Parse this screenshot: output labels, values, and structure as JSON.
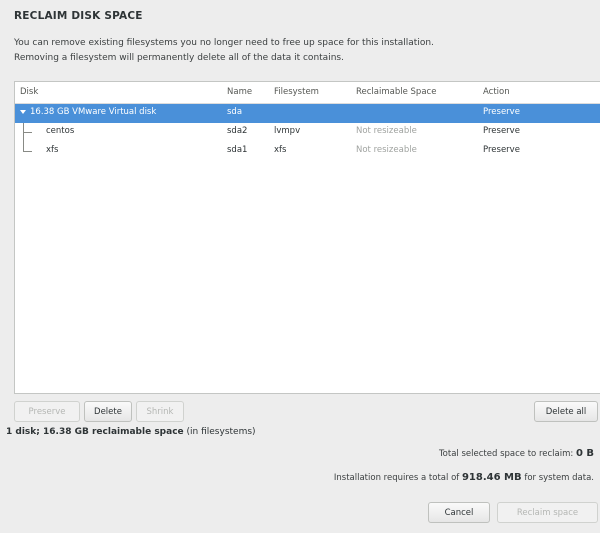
{
  "dialog": {
    "title": "RECLAIM DISK SPACE",
    "description_line1": "You can remove existing filesystems you no longer need to free up space for this installation.",
    "description_line2": "Removing a filesystem will permanently delete all of the data it contains."
  },
  "table": {
    "columns": [
      "Disk",
      "Name",
      "Filesystem",
      "Reclaimable Space",
      "Action"
    ],
    "rows": [
      {
        "disk": "16.38 GB VMware Virtual disk",
        "name": "sda",
        "filesystem": "",
        "reclaimable": "",
        "action": "Preserve",
        "selected": true
      },
      {
        "disk": "centos",
        "name": "sda2",
        "filesystem": "lvmpv",
        "reclaimable": "Not resizeable",
        "action": "Preserve",
        "selected": false
      },
      {
        "disk": "xfs",
        "name": "sda1",
        "filesystem": "xfs",
        "reclaimable": "Not resizeable",
        "action": "Preserve",
        "selected": false
      }
    ]
  },
  "toolbar": {
    "preserve_label": "Preserve",
    "delete_label": "Delete",
    "shrink_label": "Shrink",
    "delete_all_label": "Delete all"
  },
  "summary": {
    "bold_text": "1 disk; 16.38 GB reclaimable space",
    "suffix_text": "(in filesystems)"
  },
  "totals": {
    "selected_prefix": "Total selected space to reclaim:",
    "selected_value": "0 B",
    "requires_prefix": "Installation requires a total of",
    "requires_value": "918.46 MB",
    "requires_suffix": "for system data."
  },
  "footer": {
    "cancel_label": "Cancel",
    "reclaim_label": "Reclaim space"
  },
  "colors": {
    "selection": "#4a90d9",
    "background": "#ededed"
  },
  "icons": {
    "expand": "chevron-down-icon"
  }
}
